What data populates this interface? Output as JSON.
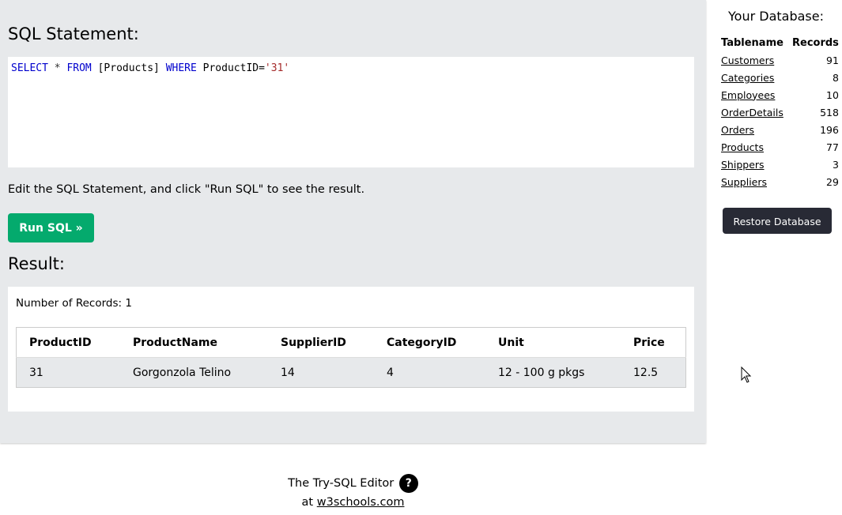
{
  "editor": {
    "title": "SQL Statement:",
    "sql": {
      "kw_select": "SELECT",
      "star": " * ",
      "kw_from": "FROM",
      "table": " [Products] ",
      "kw_where": "WHERE",
      "condition": " ProductID=",
      "value": "'31'"
    },
    "instructions": "Edit the SQL Statement, and click \"Run SQL\" to see the result.",
    "run_label": "Run SQL »"
  },
  "result": {
    "title": "Result:",
    "record_count": "Number of Records: 1",
    "columns": [
      "ProductID",
      "ProductName",
      "SupplierID",
      "CategoryID",
      "Unit",
      "Price"
    ],
    "rows": [
      [
        "31",
        "Gorgonzola Telino",
        "14",
        "4",
        "12 - 100 g pkgs",
        "12.5"
      ]
    ]
  },
  "sidebar": {
    "title": "Your Database:",
    "header_name": "Tablename",
    "header_records": "Records",
    "tables": [
      {
        "name": "Customers",
        "records": "91"
      },
      {
        "name": "Categories",
        "records": "8"
      },
      {
        "name": "Employees",
        "records": "10"
      },
      {
        "name": "OrderDetails",
        "records": "518"
      },
      {
        "name": "Orders",
        "records": "196"
      },
      {
        "name": "Products",
        "records": "77"
      },
      {
        "name": "Shippers",
        "records": "3"
      },
      {
        "name": "Suppliers",
        "records": "29"
      }
    ],
    "restore_label": "Restore Database"
  },
  "footer": {
    "editor_text": "The Try-SQL Editor",
    "help_glyph": "?",
    "at_text": "at ",
    "link_text": "w3schools.com"
  },
  "colors": {
    "run_button": "#04aa6d",
    "restore_button": "#282a35",
    "panel_bg": "#e7e9eb",
    "sql_keyword": "#0000cd",
    "sql_string": "#a52a2a"
  }
}
